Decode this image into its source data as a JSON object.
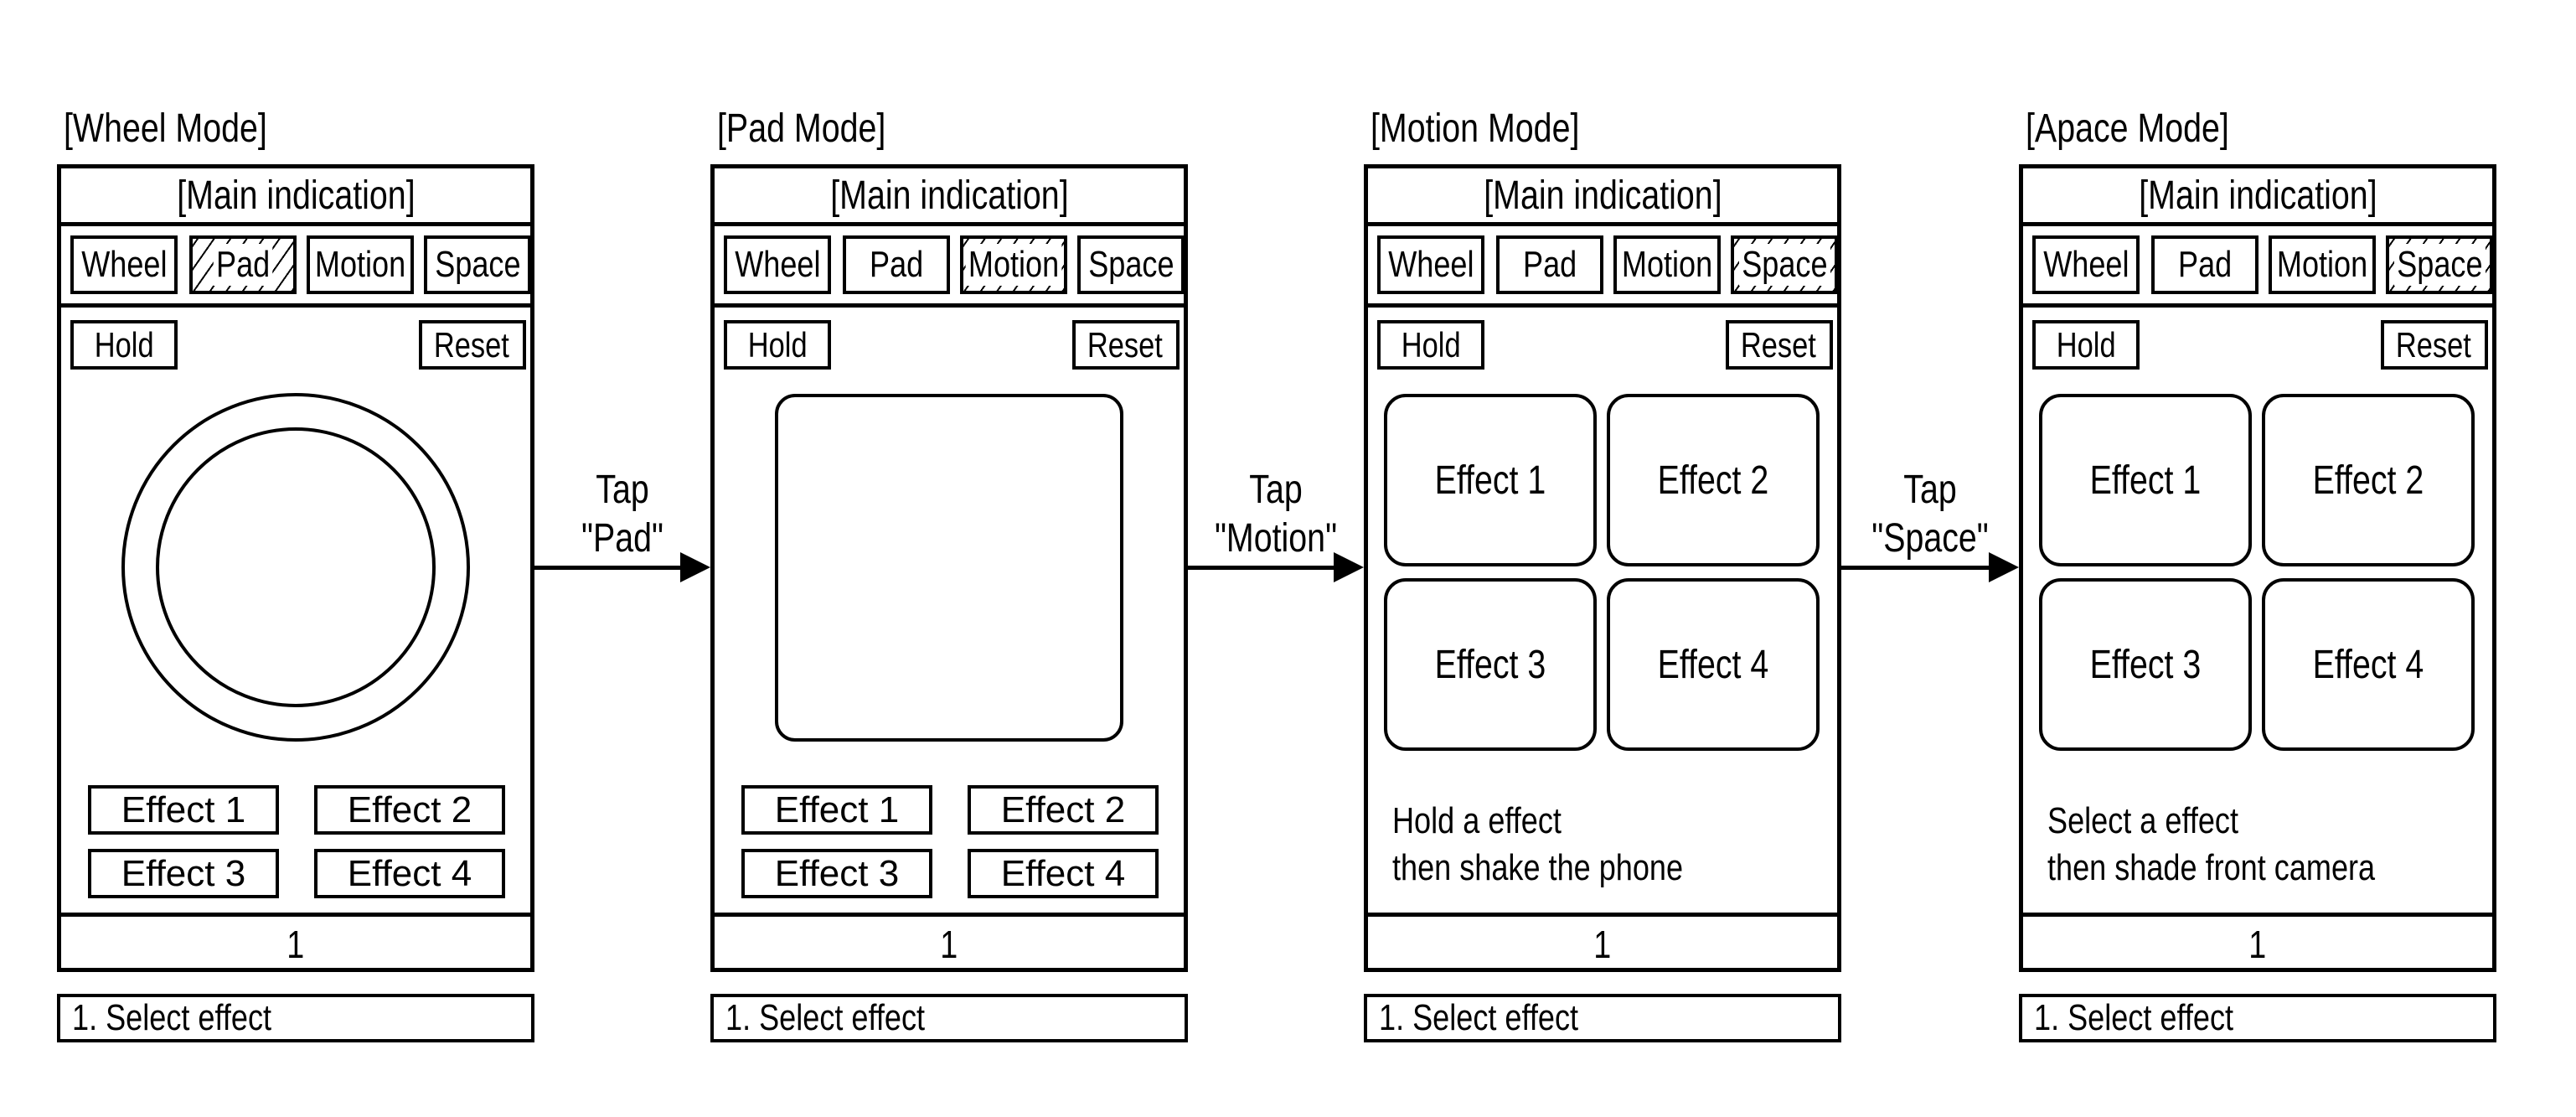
{
  "panels": [
    {
      "mode_title": "[Wheel Mode]",
      "main_indication": "[Main indication]",
      "tabs": [
        "Wheel",
        "Pad",
        "Motion",
        "Space"
      ],
      "highlighted_tab": "Pad",
      "hold_label": "Hold",
      "reset_label": "Reset",
      "control": "wheel",
      "effects": [
        "Effect 1",
        "Effect 2",
        "Effect 3",
        "Effect 4"
      ],
      "instruction": [],
      "page_number": "1",
      "caption": "1. Select effect"
    },
    {
      "mode_title": "[Pad Mode]",
      "main_indication": "[Main indication]",
      "tabs": [
        "Wheel",
        "Pad",
        "Motion",
        "Space"
      ],
      "highlighted_tab": "Motion",
      "hold_label": "Hold",
      "reset_label": "Reset",
      "control": "pad",
      "effects": [
        "Effect 1",
        "Effect 2",
        "Effect 3",
        "Effect 4"
      ],
      "instruction": [],
      "page_number": "1",
      "caption": "1. Select effect"
    },
    {
      "mode_title": "[Motion Mode]",
      "main_indication": "[Main indication]",
      "tabs": [
        "Wheel",
        "Pad",
        "Motion",
        "Space"
      ],
      "highlighted_tab": "Space",
      "hold_label": "Hold",
      "reset_label": "Reset",
      "control": "effect-grid",
      "effects": [
        "Effect 1",
        "Effect 2",
        "Effect 3",
        "Effect 4"
      ],
      "instruction": [
        "Hold a effect",
        "then shake the phone"
      ],
      "page_number": "1",
      "caption": "1. Select effect"
    },
    {
      "mode_title": "[Apace Mode]",
      "main_indication": "[Main indication]",
      "tabs": [
        "Wheel",
        "Pad",
        "Motion",
        "Space"
      ],
      "highlighted_tab": "Space",
      "hold_label": "Hold",
      "reset_label": "Reset",
      "control": "effect-grid",
      "effects": [
        "Effect 1",
        "Effect 2",
        "Effect 3",
        "Effect 4"
      ],
      "instruction": [
        "Select a effect",
        "then shade front camera"
      ],
      "page_number": "1",
      "caption": "1. Select effect"
    }
  ],
  "transitions": [
    {
      "line1": "Tap",
      "line2": "\"Pad\"",
      "icon": "arrow-right-icon"
    },
    {
      "line1": "Tap",
      "line2": "\"Motion\"",
      "icon": "arrow-right-icon"
    },
    {
      "line1": "Tap",
      "line2": "\"Space\"",
      "icon": "arrow-right-icon"
    }
  ]
}
